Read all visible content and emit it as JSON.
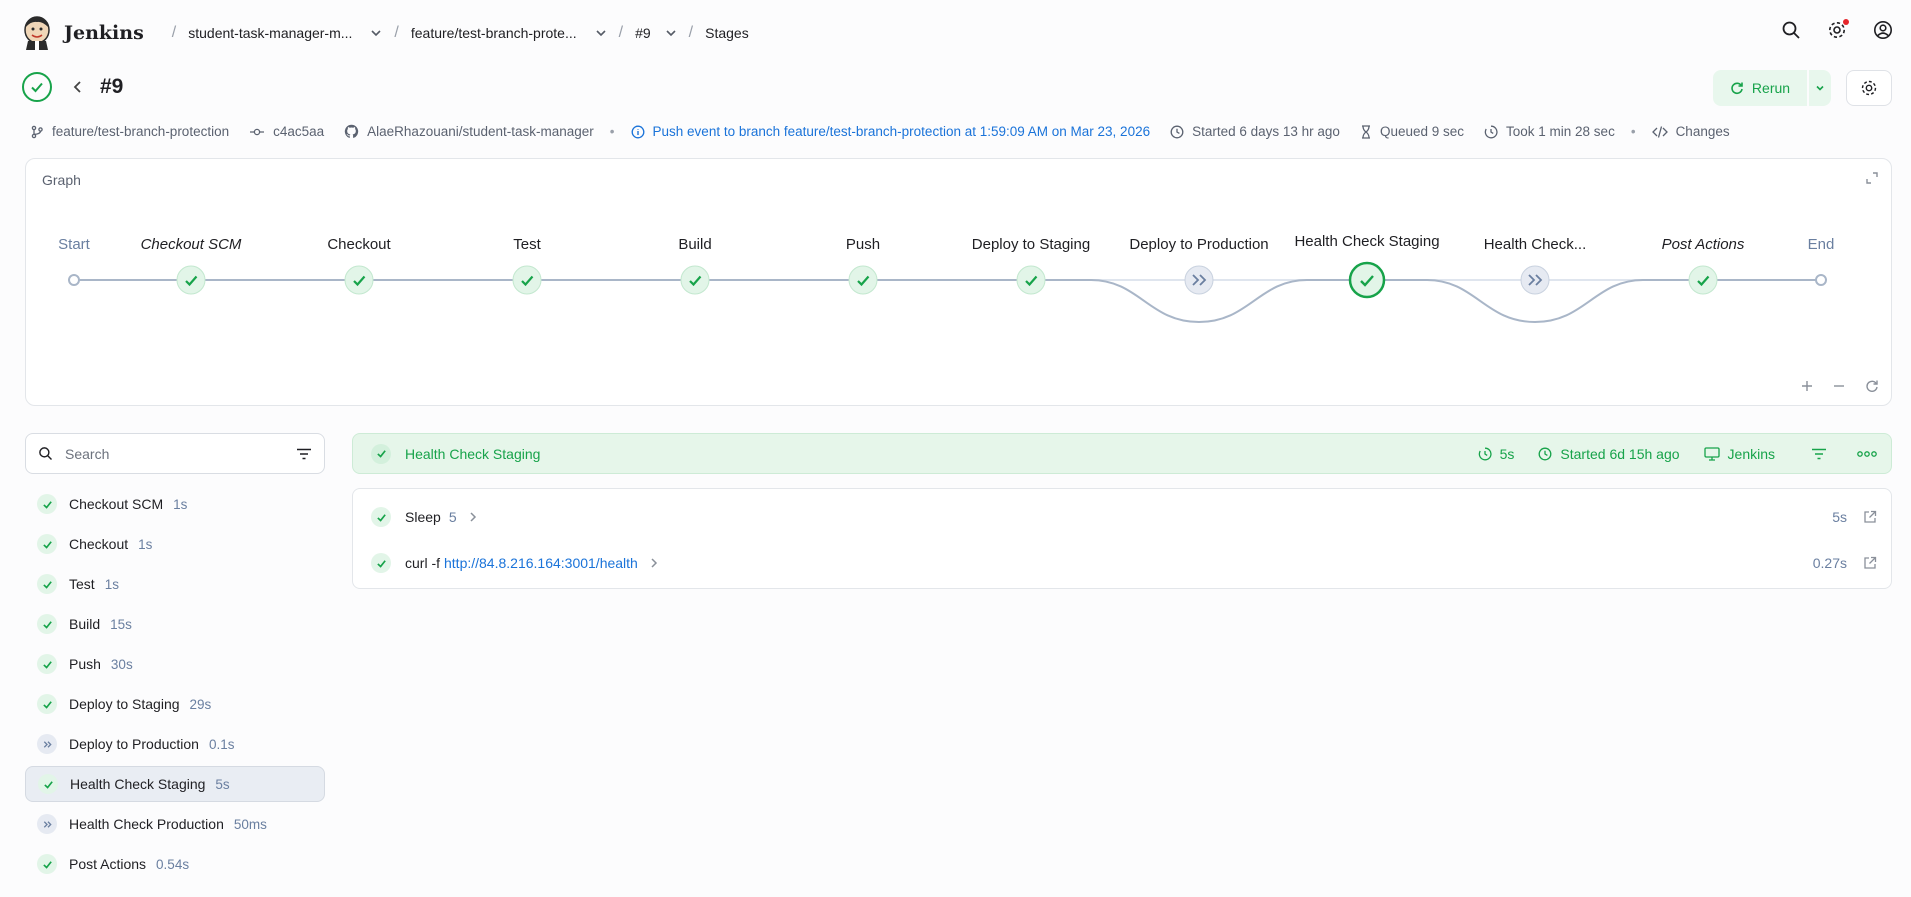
{
  "topbar": {
    "brand": "Jenkins",
    "breadcrumbs": [
      {
        "label": "student-task-manager-m..."
      },
      {
        "label": "feature/test-branch-prote..."
      },
      {
        "label": "#9"
      },
      {
        "label": "Stages"
      }
    ]
  },
  "build": {
    "title": "#9",
    "rerun_label": "Rerun"
  },
  "meta": {
    "branch": "feature/test-branch-protection",
    "commit": "c4ac5aa",
    "repo": "AlaeRhazouani/student-task-manager",
    "cause": "Push event to branch feature/test-branch-protection at 1:59:09 AM on Mar 23, 2026",
    "started": "Started 6 days 13 hr ago",
    "queued": "Queued 9 sec",
    "took": "Took 1 min 28 sec",
    "changes": "Changes"
  },
  "graph": {
    "title": "Graph",
    "nodes": [
      {
        "label": "Start",
        "kind": "start"
      },
      {
        "label": "Checkout SCM",
        "kind": "success",
        "italic": true
      },
      {
        "label": "Checkout",
        "kind": "success"
      },
      {
        "label": "Test",
        "kind": "success"
      },
      {
        "label": "Build",
        "kind": "success"
      },
      {
        "label": "Push",
        "kind": "success"
      },
      {
        "label": "Deploy to Staging",
        "kind": "success"
      },
      {
        "label": "Deploy to Production",
        "kind": "skipped"
      },
      {
        "label": "Health Check Staging",
        "kind": "selected"
      },
      {
        "label": "Health Check...",
        "kind": "skipped"
      },
      {
        "label": "Post Actions",
        "kind": "success",
        "italic": true
      },
      {
        "label": "End",
        "kind": "end"
      }
    ]
  },
  "search": {
    "placeholder": "Search"
  },
  "stages": [
    {
      "name": "Checkout SCM",
      "duration": "1s",
      "status": "success"
    },
    {
      "name": "Checkout",
      "duration": "1s",
      "status": "success"
    },
    {
      "name": "Test",
      "duration": "1s",
      "status": "success"
    },
    {
      "name": "Build",
      "duration": "15s",
      "status": "success"
    },
    {
      "name": "Push",
      "duration": "30s",
      "status": "success"
    },
    {
      "name": "Deploy to Staging",
      "duration": "29s",
      "status": "success"
    },
    {
      "name": "Deploy to Production",
      "duration": "0.1s",
      "status": "skipped"
    },
    {
      "name": "Health Check Staging",
      "duration": "5s",
      "status": "success",
      "selected": true
    },
    {
      "name": "Health Check Production",
      "duration": "50ms",
      "status": "skipped"
    },
    {
      "name": "Post Actions",
      "duration": "0.54s",
      "status": "success"
    }
  ],
  "detail": {
    "stage_name": "Health Check Staging",
    "duration": "5s",
    "started": "Started 6d 15h ago",
    "agent": "Jenkins",
    "steps": [
      {
        "name": "Sleep",
        "arg": "5",
        "duration": "5s"
      },
      {
        "name": "curl -f",
        "url": "http://84.8.216.164:3001/health",
        "duration": "0.27s"
      }
    ]
  },
  "colors": {
    "success": "#17a34a",
    "link": "#1a73d9",
    "skipped": "#6a7fa0"
  }
}
